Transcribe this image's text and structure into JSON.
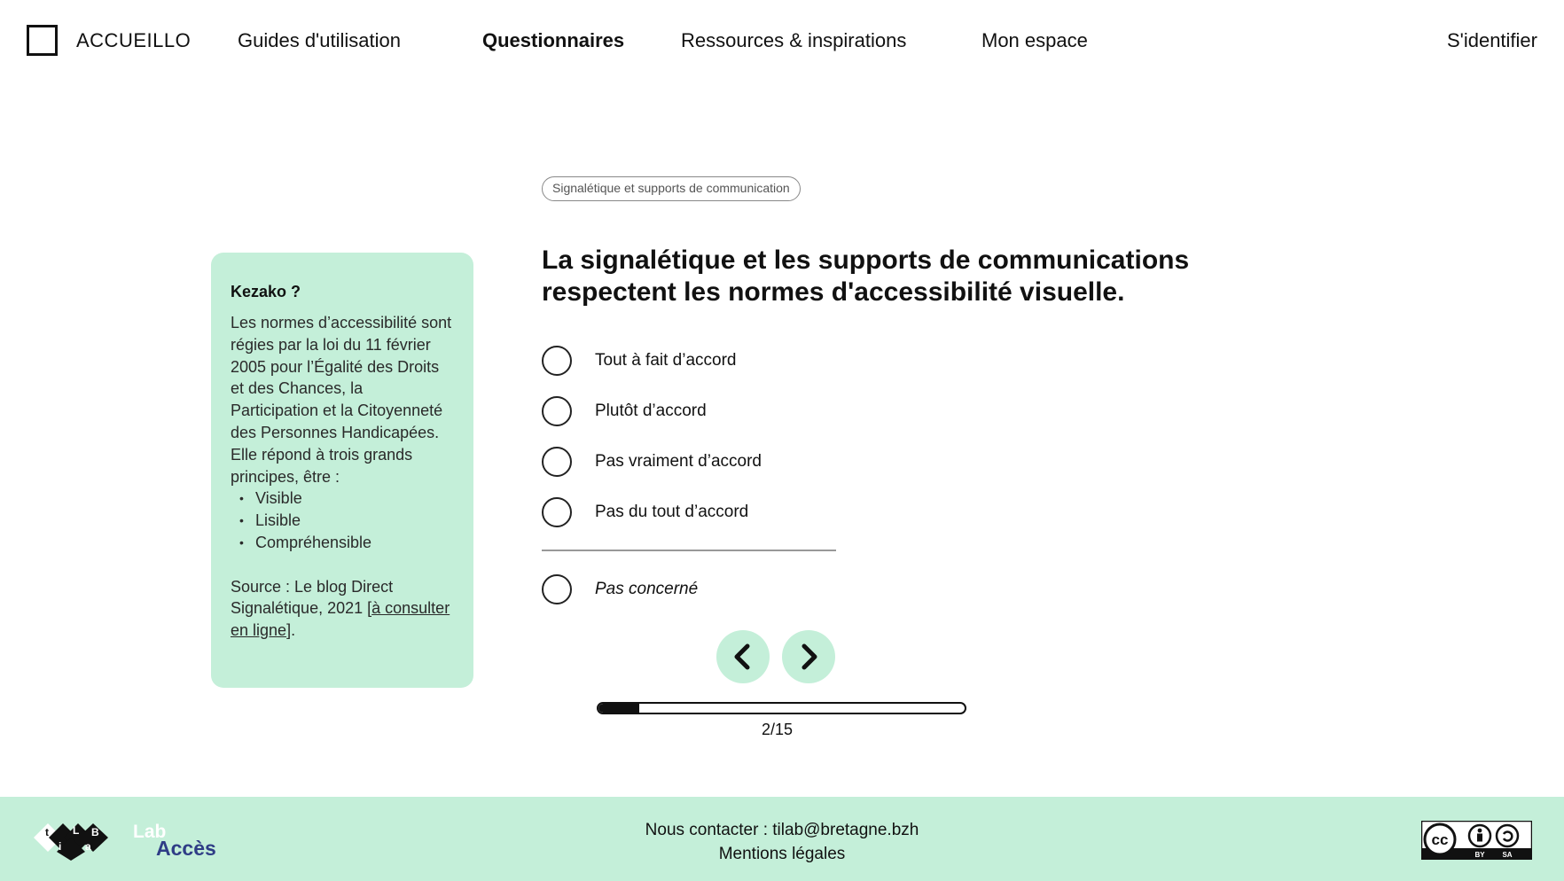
{
  "header": {
    "brand": "ACCUEILLO",
    "nav": [
      {
        "label": "Guides d'utilisation"
      },
      {
        "label": "Questionnaires"
      },
      {
        "label": "Ressources & inspirations"
      },
      {
        "label": "Mon espace"
      }
    ],
    "login": "S'identifier"
  },
  "info": {
    "title": "Kezako ?",
    "body": "Les normes d’accessibilité sont régies par la loi du 11 février 2005 pour l’Égalité des Droits et des Chances, la Participation et la Citoyenneté des Personnes Handicapées. Elle répond à trois grands principes, être :",
    "list": [
      "Visible",
      "Lisible",
      "Compréhensible"
    ],
    "source_prefix": "Source : Le blog Direct Signalétique, 2021 [",
    "source_link": "à consulter en ligne",
    "source_suffix": "]."
  },
  "question": {
    "tag": "Signalétique et supports de communication",
    "title": "La signalétique et les supports de communications respectent les normes d'accessibilité visuelle.",
    "options": [
      {
        "label": "Tout à fait d’accord"
      },
      {
        "label": "Plutôt d’accord"
      },
      {
        "label": "Pas vraiment d’accord"
      },
      {
        "label": "Pas du tout d’accord"
      }
    ],
    "not_concerned": "Pas concerné"
  },
  "progress": {
    "text": "2/15",
    "fraction": 0.111
  },
  "footer": {
    "contact": "Nous contacter : tilab@bretagne.bzh",
    "legal": "Mentions légales",
    "lab_logo_line1": "Lab",
    "lab_logo_line2": "Accès",
    "tilab_letters": [
      "t",
      "i",
      "L",
      "a",
      "B"
    ],
    "cc_label_by": "BY",
    "cc_label_sa": "SA",
    "cc_label_cc": "cc"
  },
  "colors": {
    "accent_mint": "#c4efd9",
    "lab_blue": "#2f3d86"
  }
}
